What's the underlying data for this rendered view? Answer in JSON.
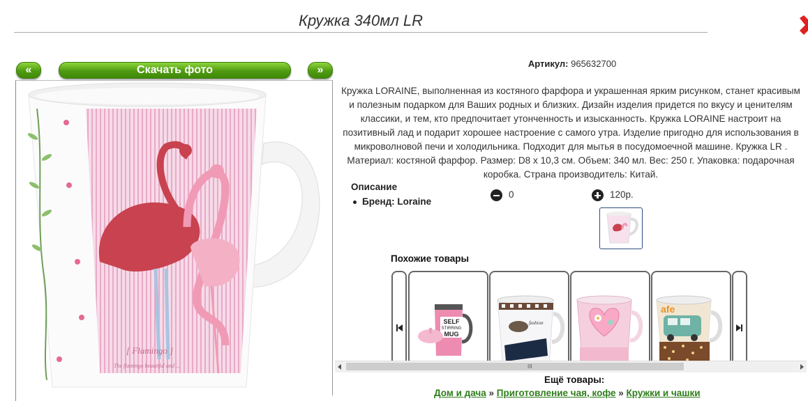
{
  "header": {
    "title": "Кружка 340мл LR"
  },
  "nav": {
    "prev_label": "«",
    "download_label": "Скачать фото",
    "next_label": "»"
  },
  "product": {
    "sku_label": "Артикул:",
    "sku_value": "965632700",
    "description": "Кружка LORAINE, выполненная из костяного фарфора и украшенная ярким рисунком, станет красивым и полезным подарком для Ваших родных и близких. Дизайн изделия придется по вкусу и ценителям классики, и тем, кто предпочитает утонченность и изысканность. Кружка LORAINE настроит на позитивный лад и подарит хорошее настроение с самого утра. Изделие пригодно для использования в микроволновой печи и холодильника. Подходит для мытья в посудомоечной машине. Кружка LR . Материал: костяной фарфор. Размер: D8 x 10,3 см. Объем: 340 мл. Вес: 250 г. Упаковка: подарочная коробка. Страна производитель: Китай.",
    "details_heading": "Описание",
    "brand_line": "Бренд: Loraine",
    "minus_value": "0",
    "plus_value": "120р."
  },
  "similar": {
    "heading": "Похожие товары",
    "items": [
      {
        "name": "self-stirring-mug",
        "mug_text": "SELF STIRRING MUG"
      },
      {
        "name": "fashion-mug"
      },
      {
        "name": "heart-mug"
      },
      {
        "name": "cafe-car-mug",
        "mug_text": "afe"
      }
    ]
  },
  "footer": {
    "more_label": "Ещё товары:",
    "crumbs": [
      "Дом и дача",
      "Приготовление чая, кофе",
      "Кружки и чашки"
    ],
    "separator": "»"
  },
  "colors": {
    "green": "#4f9a12",
    "close_red": "#e02020",
    "link_green": "#2e7d1a"
  }
}
